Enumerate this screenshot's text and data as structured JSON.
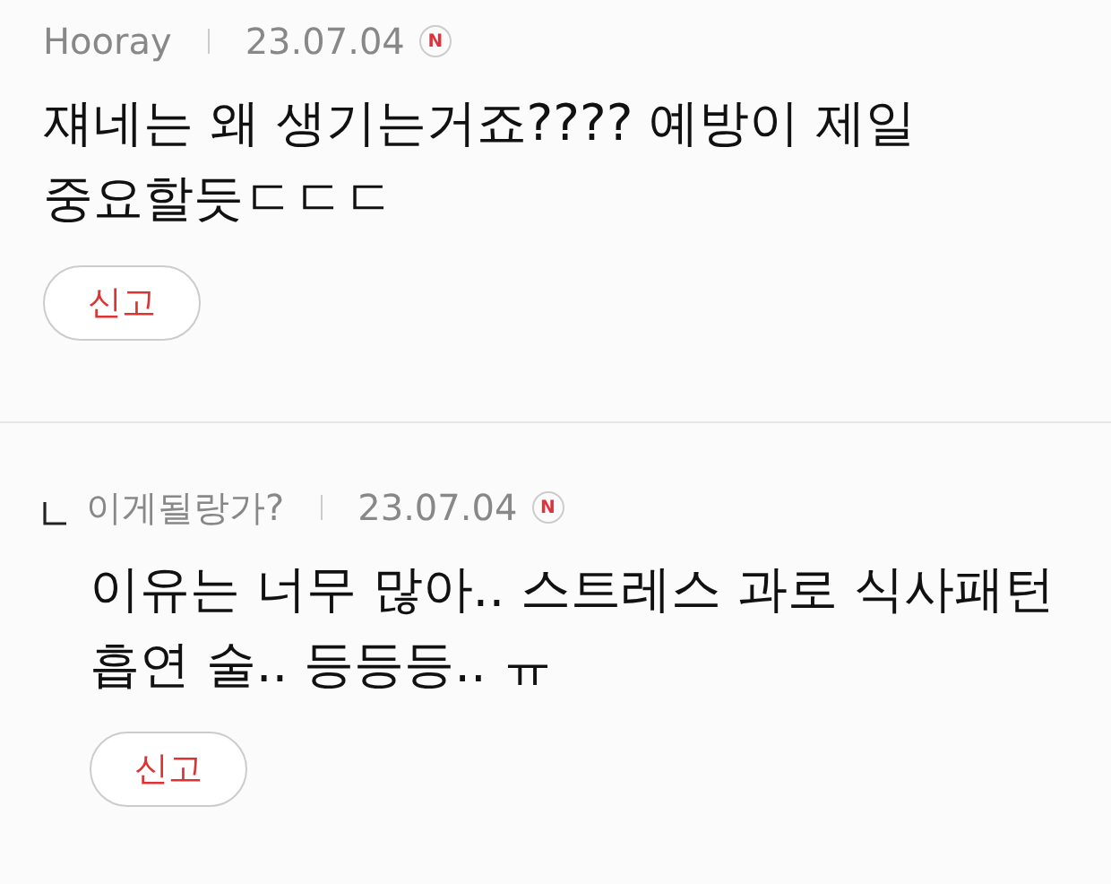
{
  "comments": [
    {
      "kind": "comment",
      "author": "Hooray",
      "date": "23.07.04",
      "badge": "N",
      "text": "쟤네는 왜 생기는거죠???? 예방이 제일 중요할듯ㄷㄷㄷ",
      "report": "신고"
    },
    {
      "kind": "reply",
      "author": "이게될랑가?",
      "date": "23.07.04",
      "badge": "N",
      "text": "이유는 너무 많아.. 스트레스 과로 식사패턴 흡연 술.. 등등등.. ㅠ",
      "report": "신고"
    }
  ]
}
